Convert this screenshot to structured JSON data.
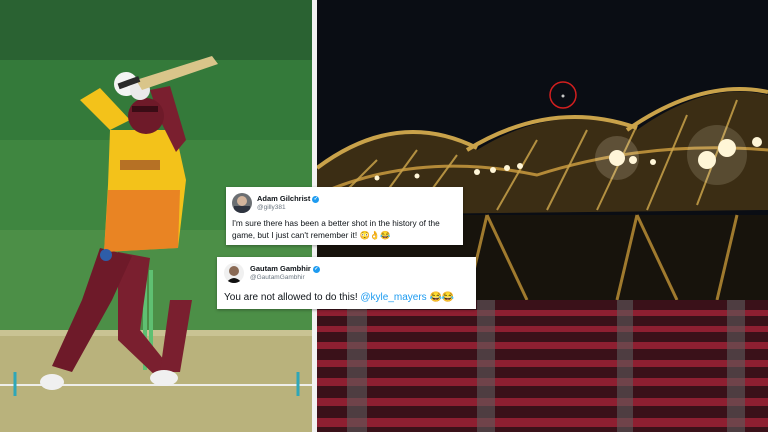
{
  "scene": {
    "left_photo": "cricket-batsman-photo",
    "right_photo": "stadium-roof-night-photo",
    "colors": {
      "pitch_green": "#3c8440",
      "jersey_yellow": "#f3c21a",
      "jersey_maroon": "#7a1f2f",
      "sky_night": "#0a0d14",
      "seat_red": "#a3243a",
      "roof_gold": "#c9a24a"
    }
  },
  "tweets": [
    {
      "name": "Adam Gilchrist",
      "handle": "@gilly381",
      "verified": true,
      "text": "I'm sure there has been a better shot in the history of the game, but I just can't remember it! 😳👌😂"
    },
    {
      "name": "Gautam Gambhir",
      "handle": "@GautamGambhir",
      "verified": true,
      "text_before_mention": "You are not allowed to do this! ",
      "mention": "@kyle_mayers",
      "text_after_mention": " 😂😂"
    }
  ]
}
